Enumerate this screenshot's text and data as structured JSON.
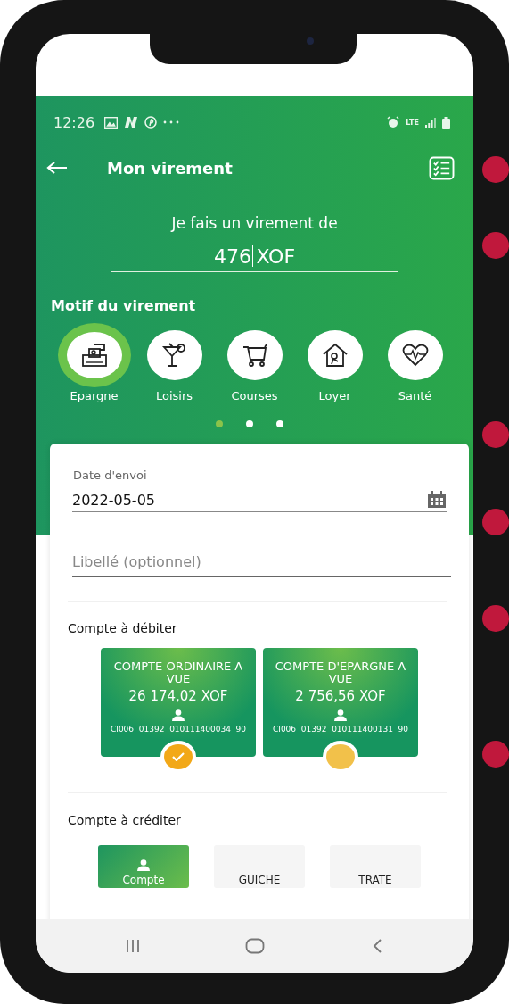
{
  "status_bar": {
    "time": "12:26",
    "network": "LTE"
  },
  "header": {
    "title": "Mon virement"
  },
  "amount": {
    "label": "Je fais un virement de",
    "value": "476",
    "currency": "XOF"
  },
  "motifs": {
    "title": "Motif du virement",
    "items": [
      {
        "label": "Epargne",
        "kind": "savings",
        "selected": true
      },
      {
        "label": "Loisirs",
        "kind": "cocktail",
        "selected": false
      },
      {
        "label": "Courses",
        "kind": "cart",
        "selected": false
      },
      {
        "label": "Loyer",
        "kind": "house",
        "selected": false
      },
      {
        "label": "Santé",
        "kind": "heart",
        "selected": false
      }
    ]
  },
  "pager": [
    {
      "selected": true
    },
    {
      "selected": false
    },
    {
      "selected": false
    }
  ],
  "form": {
    "date_label": "Date d'envoi",
    "date_value": "2022-05-05",
    "label_placeholder": "Libellé (optionnel)"
  },
  "debit": {
    "title": "Compte à débiter",
    "accounts": [
      {
        "name": "COMPTE ORDINAIRE A VUE",
        "balance": "26 174,02 XOF",
        "number": "CI006  01392  010111400034  90",
        "selected": true
      },
      {
        "name": "COMPTE D'EPARGNE A VUE",
        "balance": "2 756,56 XOF",
        "number": "CI006  01392  010111400131  90",
        "selected": false
      }
    ]
  },
  "credit": {
    "title": "Compte à créditer",
    "options": [
      {
        "label": "Compte",
        "selected": true
      },
      {
        "label": "GUICHE",
        "selected": false
      },
      {
        "label": "TRATE",
        "selected": false
      }
    ]
  }
}
